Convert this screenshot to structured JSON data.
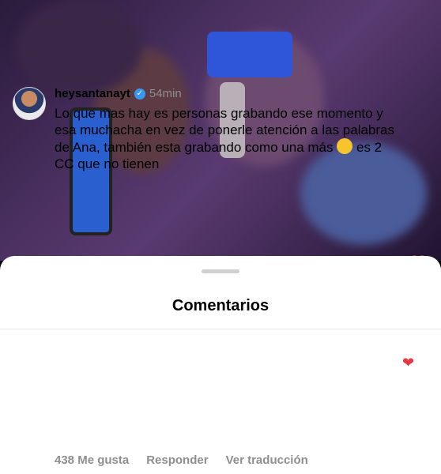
{
  "sheet": {
    "title": "Comentarios"
  },
  "comment": {
    "username": "heysantanayt",
    "time": "54min",
    "text_before_emoji": "Lo que mas hay es personas grabando ese momento y esa muchacha en vez de ponerle atención a las palabras de Ana, también esta grabando como una más",
    "text_after_emoji": "es 2 CC que no tienen",
    "likes": "438 Me gusta",
    "reply_label": "Responder",
    "translate_label": "Ver traducción"
  },
  "icons": {
    "verified": "verified-badge-icon",
    "heart": "heart-icon"
  },
  "colors": {
    "accent": "#e53945",
    "verified": "#3897f0"
  }
}
